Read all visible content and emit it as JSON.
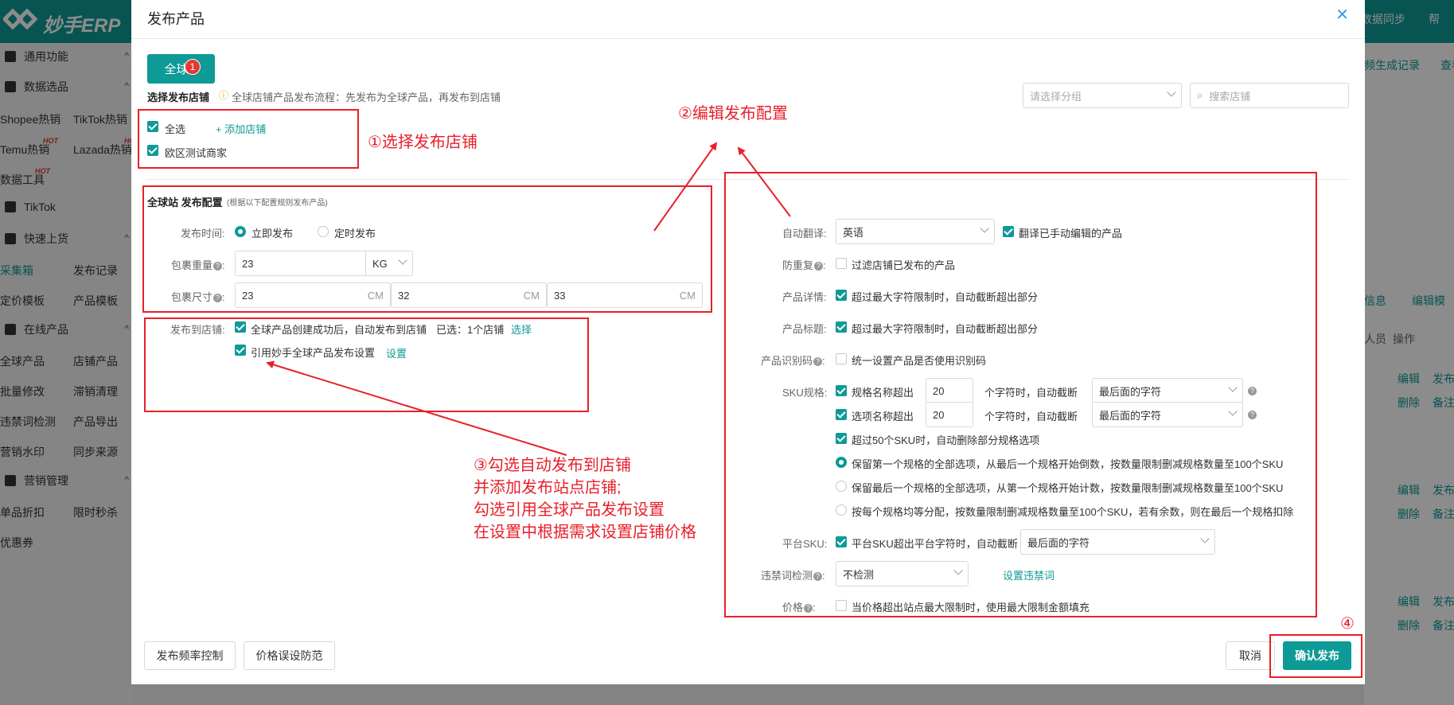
{
  "app": {
    "logo_text": "妙手ERP",
    "topbar_right": [
      "数据同步",
      "帮"
    ]
  },
  "sidebar": {
    "groups": [
      {
        "label": "通用功能",
        "icon": "grid-icon"
      },
      {
        "label": "数据选品",
        "icon": "bag-icon"
      },
      {
        "label": "TikTok",
        "icon": "tiktok-icon"
      },
      {
        "label": "快速上货",
        "icon": "lock-icon"
      },
      {
        "label": "在线产品",
        "icon": "store-icon"
      },
      {
        "label": "营销管理",
        "icon": "tag-icon"
      }
    ],
    "items": [
      "Shopee热销",
      "TikTok热销",
      "Temu热销",
      "Lazada热销",
      "数据工具",
      "采集箱",
      "发布记录",
      "定价模板",
      "产品模板",
      "全球产品",
      "店铺产品",
      "批量修改",
      "滞销清理",
      "违禁词检测",
      "产品导出",
      "营销水印",
      "同步来源",
      "单品折扣",
      "限时秒杀",
      "优惠券"
    ],
    "hot_label": "HOT"
  },
  "background": {
    "texts": [
      "频生成记录",
      "查看",
      "信息",
      "编辑模",
      "人员",
      "操作",
      "编辑",
      "发布",
      "删除",
      "备注"
    ]
  },
  "modal": {
    "title": "发布产品",
    "close_icon": "close-icon",
    "global_button": "全球",
    "badge_1": "1",
    "select_store_label": "选择发布店铺",
    "flow_hint": "全球店铺产品发布流程：先发布为全球产品，再发布到店铺",
    "group_placeholder": "请选择分组",
    "search_placeholder": "搜索店铺",
    "select_all": "全选",
    "add_store": "+ 添加店铺",
    "store_name": "欧区测试商家",
    "config_title": "全球站 发布配置",
    "config_note": "(根据以下配置规则发布产品)",
    "publish_time_label": "发布时间:",
    "publish_now": "立即发布",
    "publish_scheduled": "定时发布",
    "weight_label": "包裹重量",
    "weight_value": "23",
    "weight_unit": "KG",
    "size_label": "包裹尺寸",
    "size_values": [
      "23",
      "32",
      "33"
    ],
    "size_unit": "CM",
    "publish_to_store_label": "发布到店铺:",
    "auto_publish": "全球产品创建成功后，自动发布到店铺",
    "selected_count": "已选：1个店铺",
    "select_link": "选择",
    "use_settings": "引用妙手全球产品发布设置",
    "settings_link": "设置",
    "right": {
      "auto_translate_label": "自动翻译:",
      "auto_translate_value": "英语",
      "translate_edited": "翻译已手动编辑的产品",
      "dedupe_label": "防重复",
      "dedupe_text": "过滤店铺已发布的产品",
      "detail_label": "产品详情:",
      "detail_text": "超过最大字符限制时，自动截断超出部分",
      "title_label": "产品标题:",
      "title_text": "超过最大字符限制时，自动截断超出部分",
      "idcode_label": "产品识别码",
      "idcode_text": "统一设置产品是否使用识别码",
      "sku_label": "SKU规格:",
      "spec_name_exceed": "规格名称超出",
      "option_name_exceed": "选项名称超出",
      "spec_limit": "20",
      "option_limit": "20",
      "chars_truncate": "个字符时，自动截断",
      "truncate_mode": "最后面的字符",
      "over50": "超过50个SKU时，自动删除部分规格选项",
      "keep_first": "保留第一个规格的全部选项，从最后一个规格开始倒数，按数量限制删减规格数量至100个SKU",
      "keep_last": "保留最后一个规格的全部选项，从第一个规格开始计数，按数量限制删减规格数量至100个SKU",
      "average": "按每个规格均等分配，按数量限制删减规格数量至100个SKU，若有余数，则在最后一个规格扣除",
      "platform_sku_label": "平台SKU:",
      "platform_sku_text": "平台SKU超出平台字符时，自动截断",
      "platform_sku_mode": "最后面的字符",
      "forbidden_label": "违禁词检测",
      "forbidden_value": "不检测",
      "forbidden_link": "设置违禁词",
      "price_label": "价格",
      "price_text": "当价格超出站点最大限制时，使用最大限制金额填充"
    },
    "footer": {
      "freq_control": "发布频率控制",
      "price_guard": "价格误设防范",
      "cancel": "取消",
      "confirm": "确认发布"
    }
  },
  "annotations": {
    "step1": "①选择发布店铺",
    "step2": "②编辑发布配置",
    "step3_lines": [
      "③勾选自动发布到店铺",
      "并添加发布站点店铺;",
      "勾选引用全球产品发布设置",
      "在设置中根据需求设置店铺价格"
    ],
    "step4": "④"
  },
  "colors": {
    "brand": "#0e9a96",
    "annotation_red": "#e8202a"
  }
}
